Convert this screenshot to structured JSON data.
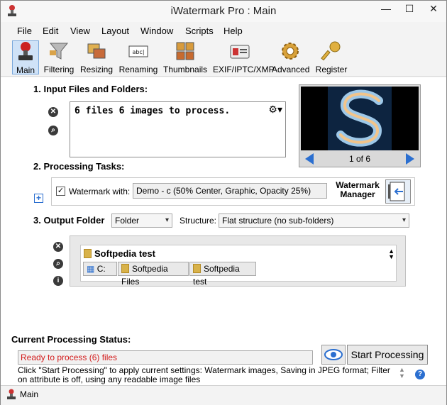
{
  "window": {
    "title": "iWatermark Pro : Main"
  },
  "menubar": {
    "items": [
      "File",
      "Edit",
      "View",
      "Layout",
      "Window",
      "Scripts",
      "Help"
    ]
  },
  "toolbar": {
    "items": [
      {
        "label": "Main",
        "icon": "stamp-icon",
        "active": true
      },
      {
        "label": "Filtering",
        "icon": "funnel-icon"
      },
      {
        "label": "Resizing",
        "icon": "resize-icon"
      },
      {
        "label": "Renaming",
        "icon": "rename-icon"
      },
      {
        "label": "Thumbnails",
        "icon": "thumbnails-icon"
      },
      {
        "label": "EXIF/IPTC/XMP",
        "icon": "id-card-icon"
      },
      {
        "label": "Advanced",
        "icon": "gear-icon"
      },
      {
        "label": "Register",
        "icon": "key-icon"
      }
    ]
  },
  "input": {
    "title": "1. Input Files and Folders:",
    "summary": "6 files 6 images to process."
  },
  "preview": {
    "page_current": "1",
    "page_of": "of",
    "page_total": "6"
  },
  "tasks": {
    "title": "2. Processing Tasks:",
    "checkbox_label": "Watermark with:",
    "watermark_value": "Demo - c (50% Center, Graphic, Opacity 25%)",
    "manager_line1": "Watermark",
    "manager_line2": "Manager"
  },
  "output": {
    "title": "3. Output Folder",
    "folder_select": "Folder",
    "structure_label": "Structure:",
    "structure_select": "Flat structure (no sub-folders)",
    "folder_name": "Softpedia test",
    "breadcrumb": [
      "C:",
      "Softpedia Files",
      "Softpedia test"
    ]
  },
  "status": {
    "title": "Current Processing Status:",
    "value": "Ready to process (6) files",
    "start_label": "Start Processing",
    "help_text": "Click \"Start Processing\" to apply current settings: Watermark images, Saving in JPEG format; Filter on attribute is off, using any readable image files"
  },
  "statusbar": {
    "label": "Main"
  },
  "colors": {
    "accent": "#2b6fd0",
    "status_red": "#d31c1c",
    "active_tool": "#cfe2f7"
  }
}
